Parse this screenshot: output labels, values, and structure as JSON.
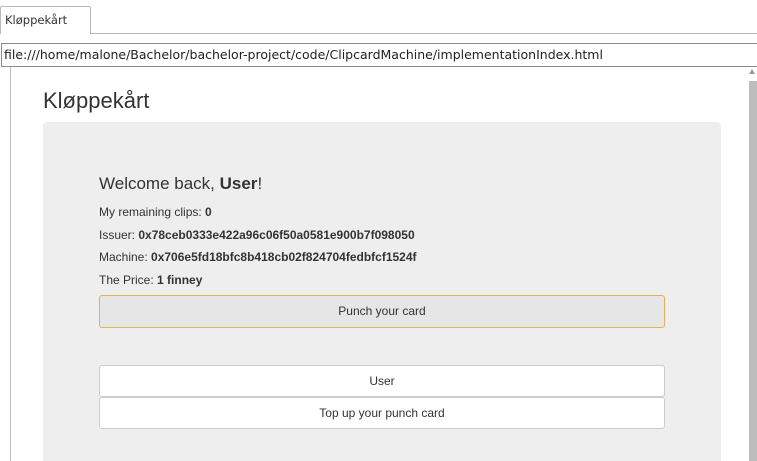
{
  "tab": {
    "title": "Kløppekårt"
  },
  "address_bar": {
    "url": "file:///home/malone/Bachelor/bachelor-project/code/ClipcardMachine/implementationIndex.html"
  },
  "page": {
    "title": "Kløppekårt",
    "welcome_prefix": "Welcome back, ",
    "user_name": "User",
    "welcome_suffix": "!",
    "clips_label": "My remaining clips: ",
    "clips_value": "0",
    "issuer_label": "Issuer: ",
    "issuer_value": "0x78ceb0333e422a96c06f50a0581e900b7f098050",
    "machine_label": "Machine: ",
    "machine_value": "0x706e5fd18bfc8b418cb02f824704fedbfcf1524f",
    "price_label": "The Price: ",
    "price_value": "1 finney",
    "punch_button": "Punch your card",
    "user_button": "User",
    "topup_button": "Top up your punch card"
  },
  "colors": {
    "card_bg": "#eeeeee",
    "focus_border": "#e0b25a"
  }
}
